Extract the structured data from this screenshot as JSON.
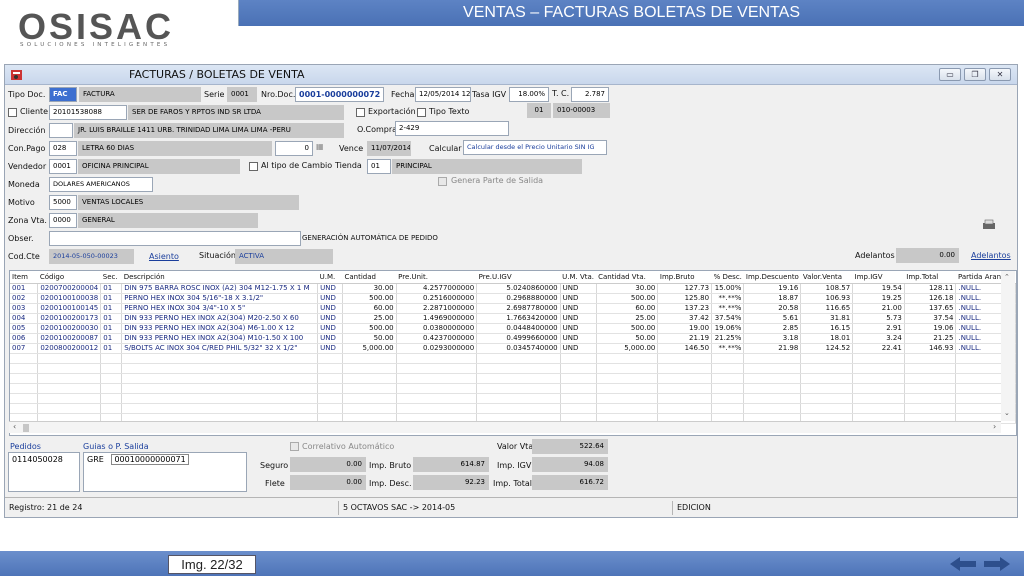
{
  "logo": {
    "name": "OSISAC",
    "tagline": "SOLUCIONES INTELIGENTES"
  },
  "banner": "VENTAS – FACTURAS BOLETAS DE VENTAS",
  "window": {
    "title": "FACTURAS / BOLETAS DE VENTA"
  },
  "form": {
    "tipo_doc_label": "Tipo Doc.",
    "tipo_doc_code": "FAC",
    "tipo_doc_name": "FACTURA",
    "serie_label": "Serie",
    "serie": "0001",
    "nro_doc_label": "Nro.Doc.",
    "nro_doc": "0001-0000000072",
    "fecha_label": "Fecha",
    "fecha": "12/05/2014 12",
    "tasa_igv_label": "Tasa IGV",
    "tasa_igv": "18.00%",
    "tc_label": "T. C.",
    "tc": "2.787",
    "cliente_label": "Cliente",
    "cliente_ruc": "20101538088",
    "cliente_name": "SER DE FAROS Y RPTOS IND SR LTDA",
    "exportacion_label": "Exportación",
    "tipo_texto_label": "Tipo Texto",
    "tipo_texto_code": "01",
    "tipo_texto_val": "010-00003",
    "direccion_label": "Dirección",
    "direccion": "JR. LUIS BRAILLE 1411 URB. TRINIDAD LIMA LIMA LIMA -PERU",
    "ocompra_label": "O.Compra",
    "ocompra": "2-429",
    "conpago_label": "Con.Pago",
    "conpago_code": "028",
    "conpago_name": "LETRA 60 DIAS",
    "conpago_num": "0",
    "vence_label": "Vence",
    "vence": "11/07/2014",
    "calcular_label": "Calcular",
    "calcular": "Calcular desde el Precio Unitario SIN IG",
    "vendedor_label": "Vendedor",
    "vendedor_code": "0001",
    "vendedor_name": "OFICINA PRINCIPAL",
    "altipo_label": "Al tipo de Cambio",
    "tienda_label": "Tienda",
    "tienda_code": "01",
    "tienda_name": "PRINCIPAL",
    "moneda_label": "Moneda",
    "moneda": "DOLARES AMERICANOS",
    "genera_label": "Genera Parte de Salida",
    "motivo_label": "Motivo",
    "motivo_code": "5000",
    "motivo_name": "VENTAS LOCALES",
    "zona_label": "Zona Vta.",
    "zona_code": "0000",
    "zona_name": "GENERAL",
    "obser_label": "Obser.",
    "obser_text": "GENERACIÓN AUTOMÁTICA DE PEDIDO",
    "codcte_label": "Cod.Cte",
    "codcte": "2014-05-050-00023",
    "asiento_label": "Asiento",
    "situacion_label": "Situación",
    "situacion": "ACTIVA",
    "adelantos_label": "Adelantos",
    "adelantos": "0.00",
    "adelantos_link": "Adelantos"
  },
  "grid": {
    "headers": [
      "Item",
      "Código",
      "Sec.",
      "Descripción",
      "U.M.",
      "Cantidad",
      "Pre.Unit.",
      "Pre.U.IGV",
      "U.M. Vta.",
      "Cantidad Vta.",
      "Imp.Bruto",
      "% Desc.",
      "Imp.Descuento",
      "Valor.Venta",
      "Imp.IGV",
      "Imp.Total",
      "Partida Arancel."
    ],
    "rows": [
      [
        "001",
        "0200700200004",
        "01",
        "DIN 975 BARRA ROSC INOX (A2) 304 M12-1.75 X 1 M",
        "UND",
        "30.00",
        "4.2577000000",
        "5.0240860000",
        "UND",
        "30.00",
        "127.73",
        "15.00%",
        "19.16",
        "108.57",
        "19.54",
        "128.11",
        ".NULL."
      ],
      [
        "002",
        "0200100100038",
        "01",
        "PERNO HEX INOX 304 5/16\"-18 X 3.1/2\"",
        "UND",
        "500.00",
        "0.2516000000",
        "0.2968880000",
        "UND",
        "500.00",
        "125.80",
        "**.**%",
        "18.87",
        "106.93",
        "19.25",
        "126.18",
        ".NULL."
      ],
      [
        "003",
        "0200100100145",
        "01",
        "PERNO HEX INOX 304 3/4\"-10 X 5\"",
        "UND",
        "60.00",
        "2.2871000000",
        "2.6987780000",
        "UND",
        "60.00",
        "137.23",
        "**.**%",
        "20.58",
        "116.65",
        "21.00",
        "137.65",
        ".NULL."
      ],
      [
        "004",
        "0200100200173",
        "01",
        "DIN 933 PERNO HEX INOX A2(304) M20-2.50 X 60",
        "UND",
        "25.00",
        "1.4969000000",
        "1.7663420000",
        "UND",
        "25.00",
        "37.42",
        "37.54%",
        "5.61",
        "31.81",
        "5.73",
        "37.54",
        ".NULL."
      ],
      [
        "005",
        "0200100200030",
        "01",
        "DIN 933 PERNO HEX INOX A2(304) M6-1.00 X 12",
        "UND",
        "500.00",
        "0.0380000000",
        "0.0448400000",
        "UND",
        "500.00",
        "19.00",
        "19.06%",
        "2.85",
        "16.15",
        "2.91",
        "19.06",
        ".NULL."
      ],
      [
        "006",
        "0200100200087",
        "01",
        "DIN 933 PERNO HEX INOX A2(304) M10-1.50 X 100",
        "UND",
        "50.00",
        "0.4237000000",
        "0.4999660000",
        "UND",
        "50.00",
        "21.19",
        "21.25%",
        "3.18",
        "18.01",
        "3.24",
        "21.25",
        ".NULL."
      ],
      [
        "007",
        "0200800200012",
        "01",
        "S/BOLTS AC INOX 304 C/RED PHIL 5/32\" 32 X 1/2\"",
        "UND",
        "5,000.00",
        "0.0293000000",
        "0.0345740000",
        "UND",
        "5,000.00",
        "146.50",
        "**.**%",
        "21.98",
        "124.52",
        "22.41",
        "146.93",
        ".NULL."
      ]
    ]
  },
  "bottom": {
    "pedidos_label": "Pedidos",
    "pedido": "0114050028",
    "guias_label": "Guias o P. Salida",
    "guia_code": "GRE",
    "guia_num": "00010000000071",
    "correlativo_label": "Correlativo Automático",
    "seguro_label": "Seguro",
    "seguro": "0.00",
    "flete_label": "Flete",
    "flete": "0.00",
    "imp_bruto_label": "Imp. Bruto",
    "imp_bruto": "614.87",
    "imp_desc_label": "Imp. Desc.",
    "imp_desc": "92.23",
    "valor_vta_label": "Valor Vta",
    "valor_vta": "522.64",
    "imp_igv_label": "Imp. IGV",
    "imp_igv": "94.08",
    "imp_total_label": "Imp. Total",
    "imp_total": "616.72"
  },
  "status": {
    "registro": "Registro: 21 de 24",
    "empresa": "5 OCTAVOS SAC -> 2014-05",
    "modo": "EDICION"
  },
  "footer": {
    "img": "Img.  22/32"
  }
}
